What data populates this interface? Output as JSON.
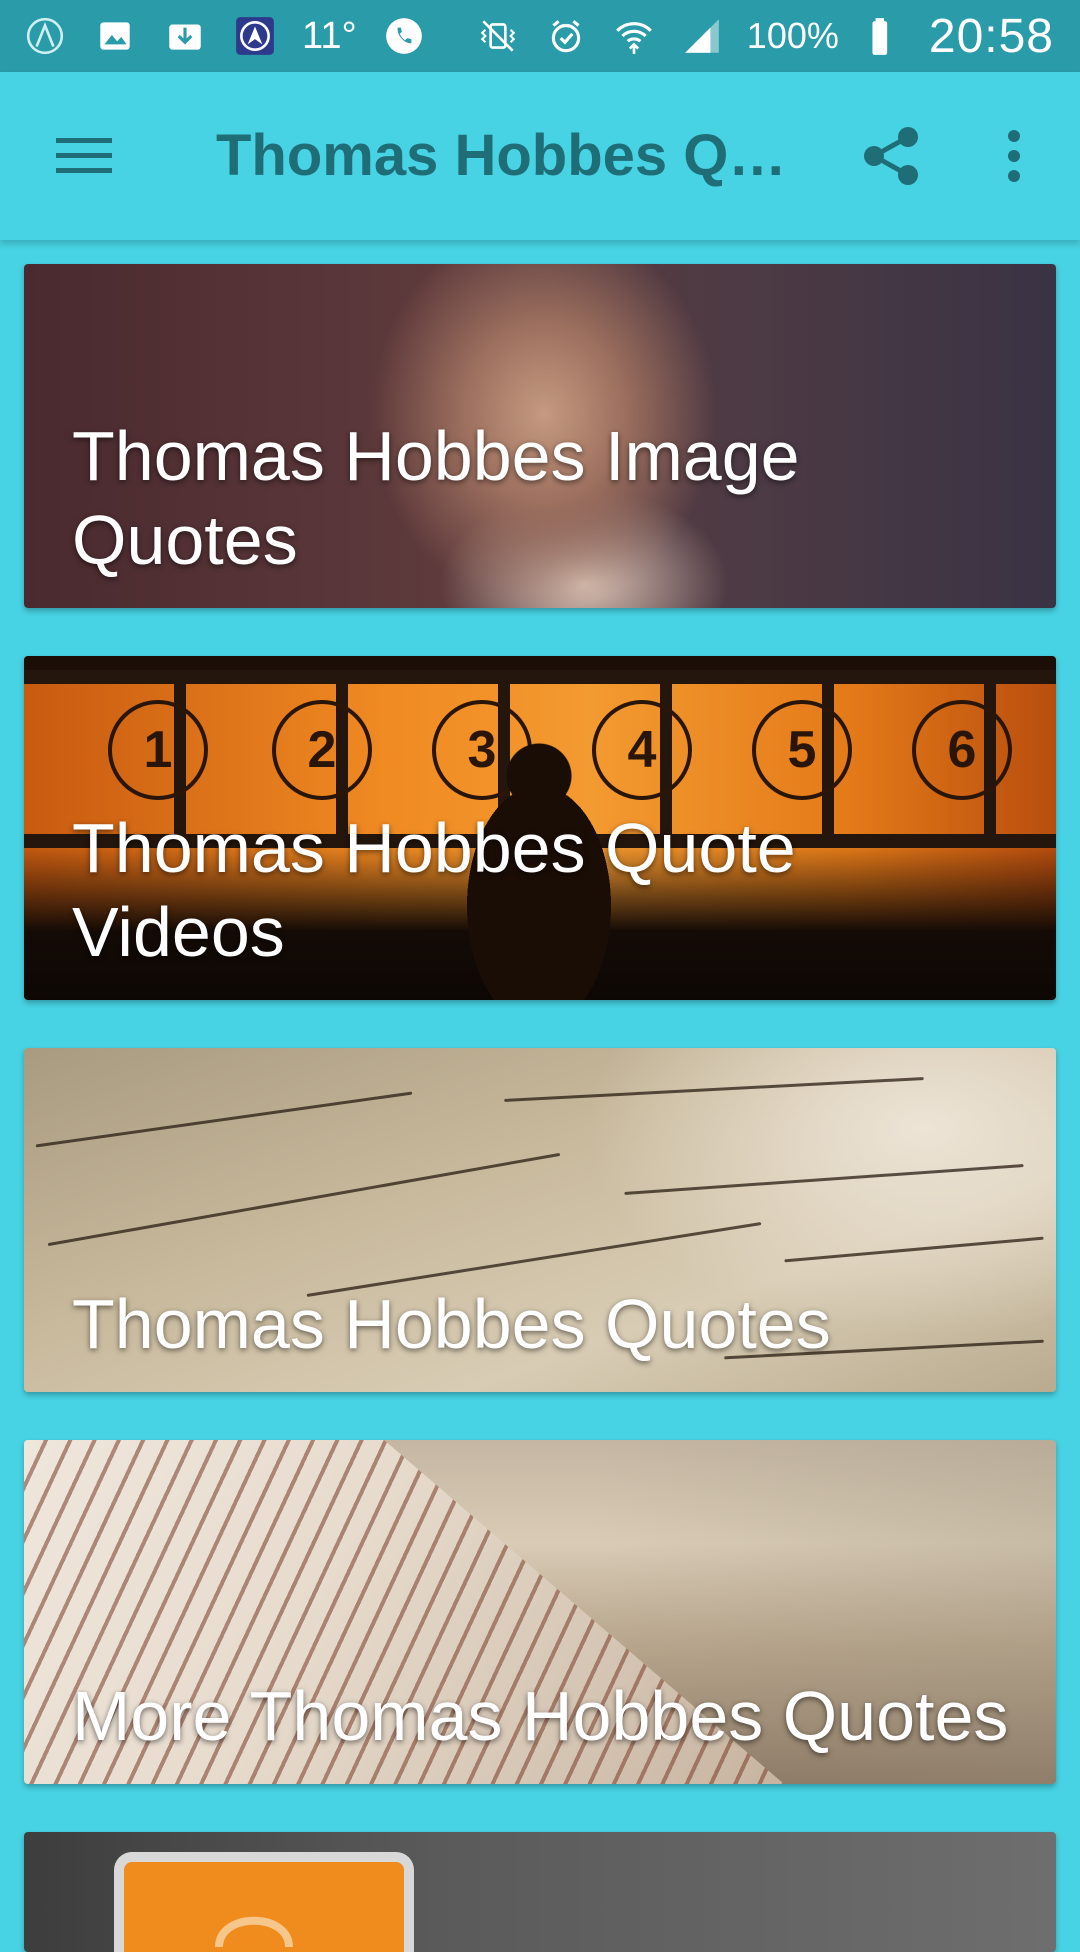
{
  "status_bar": {
    "temperature": "11°",
    "battery_percent": "100%",
    "time": "20:58",
    "icons_left": [
      "app-a-icon",
      "gallery-icon",
      "download-icon",
      "navigation-app-icon",
      "weather-icon",
      "phone-call-icon"
    ],
    "icons_right": [
      "vibrate-icon",
      "alarm-icon",
      "wifi-icon",
      "signal-icon",
      "battery-icon"
    ]
  },
  "app_bar": {
    "title": "Thomas Hobbes Quotes",
    "menu_icon": "hamburger-menu-icon",
    "share_icon": "share-icon",
    "more_icon": "more-vert-icon"
  },
  "cards": [
    {
      "label": "Thomas Hobbes Image Quotes",
      "image": "portrait"
    },
    {
      "label": "Thomas Hobbes Quote Videos",
      "image": "film-strip-sunset"
    },
    {
      "label": "Thomas Hobbes Quotes",
      "image": "handwritten-letter"
    },
    {
      "label": "More Thomas Hobbes Quotes",
      "image": "open-book"
    },
    {
      "label": "",
      "image": "phone-headphones"
    }
  ],
  "film_numbers": [
    "1",
    "2",
    "3",
    "4",
    "5",
    "6"
  ],
  "colors": {
    "status_bar": "#2a9ba8",
    "app_bar": "#47d3e4",
    "title_text": "#1f6d77",
    "background": "#47d3e4"
  }
}
